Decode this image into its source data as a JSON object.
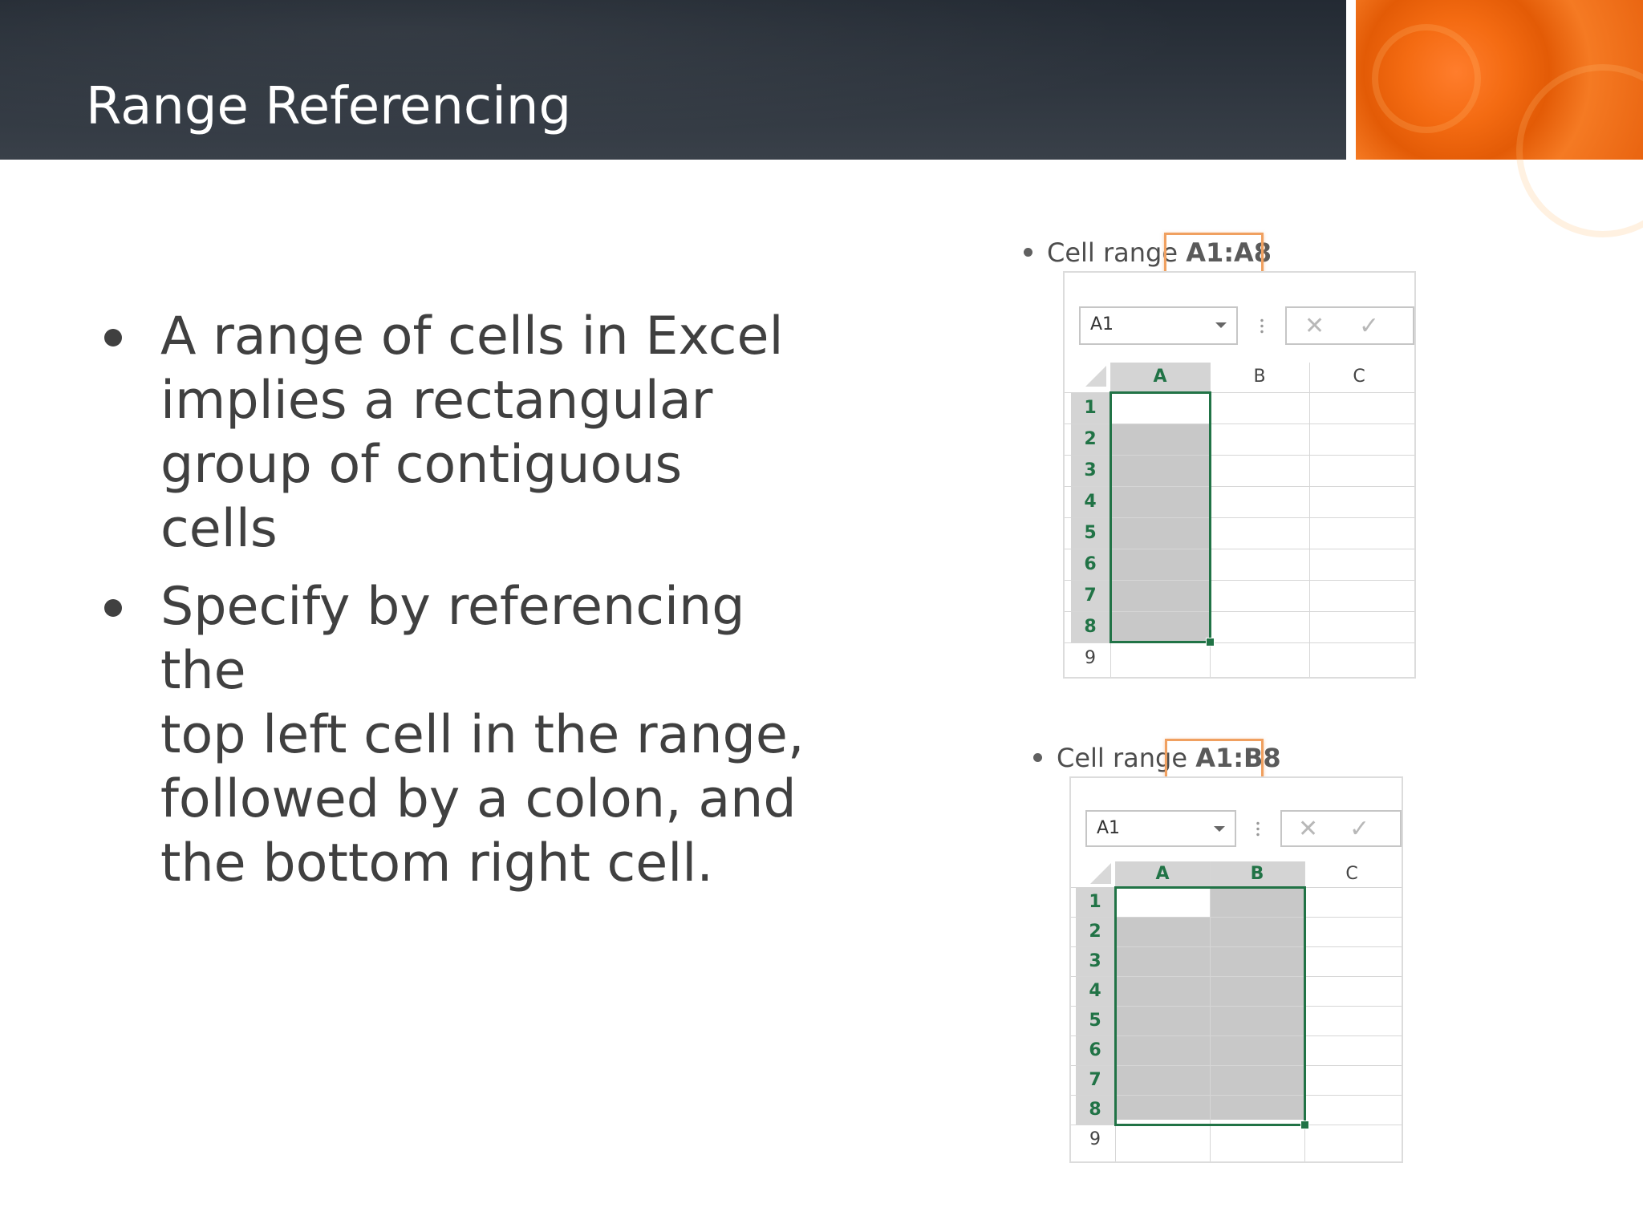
{
  "slide": {
    "title": "Range Referencing",
    "bullets": [
      "A range of cells in Excel\nimplies a rectangular\ngroup of contiguous cells",
      "Specify by referencing the\ntop left cell in the range,\nfollowed by a colon, and\nthe bottom right cell."
    ]
  },
  "examples": [
    {
      "caption_prefix": "Cell range ",
      "caption_range": "A1:A8",
      "namebox_value": "A1",
      "columns": [
        "A",
        "B",
        "C"
      ],
      "selected_columns": [
        "A"
      ],
      "rows": [
        "1",
        "2",
        "3",
        "4",
        "5",
        "6",
        "7",
        "8",
        "9"
      ],
      "selected_rows": [
        "1",
        "2",
        "3",
        "4",
        "5",
        "6",
        "7",
        "8"
      ]
    },
    {
      "caption_prefix": "Cell range ",
      "caption_range": "A1:B8",
      "namebox_value": "A1",
      "columns": [
        "A",
        "B",
        "C"
      ],
      "selected_columns": [
        "A",
        "B"
      ],
      "rows": [
        "1",
        "2",
        "3",
        "4",
        "5",
        "6",
        "7",
        "8",
        "9"
      ],
      "selected_rows": [
        "1",
        "2",
        "3",
        "4",
        "5",
        "6",
        "7",
        "8"
      ]
    }
  ],
  "icons": {
    "cancel": "close-icon",
    "enter": "checkmark-icon",
    "dropdown": "chevron-down-icon"
  },
  "colors": {
    "excel_green": "#217346",
    "highlight_orange": "#f0a060",
    "accent_orange": "#f46b12",
    "header_dark": "#2d343d"
  }
}
